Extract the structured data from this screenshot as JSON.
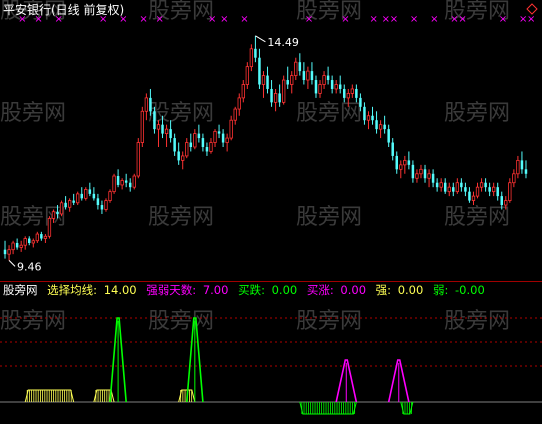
{
  "colors": {
    "up": "#ff3232",
    "down": "#54fcfc",
    "magenta": "#ff00ff",
    "yellow": "#ffff54",
    "green": "#00ff00",
    "white": "#ffffff",
    "gray": "#808080",
    "wm": "#3a3a3a",
    "divider": "#a00000",
    "dotted": "#b00000"
  },
  "header": {
    "title": "平安银行(日线 前复权)",
    "high_label": "14.49",
    "low_label": "9.46",
    "corner_icon": "diamond-icon"
  },
  "watermark": {
    "text": "股旁网"
  },
  "indicator_header": {
    "name": "股旁网",
    "items": [
      {
        "label": "选择均线:",
        "value": "14.00"
      },
      {
        "label": "强弱天数:",
        "value": "7.00"
      },
      {
        "label": "买跌:",
        "value": "0.00"
      },
      {
        "label": "买涨:",
        "value": "0.00"
      },
      {
        "label": "强:",
        "value": "0.00"
      },
      {
        "label": "弱:",
        "value": "-0.00"
      }
    ]
  },
  "chart_data": [
    {
      "type": "candlestick",
      "ylim": [
        9.2,
        14.8
      ],
      "high_marker": 14.49,
      "low_marker": 9.46,
      "x_marks": [
        4,
        8,
        13,
        24,
        29,
        34,
        38,
        51,
        54,
        59,
        75,
        84,
        91,
        94,
        96,
        101,
        106,
        111,
        113,
        123,
        128,
        130,
        135,
        138
      ],
      "ohlc": [
        [
          9.7,
          9.9,
          9.5,
          9.6
        ],
        [
          9.6,
          9.8,
          9.46,
          9.7
        ],
        [
          9.7,
          9.9,
          9.6,
          9.85
        ],
        [
          9.85,
          9.95,
          9.7,
          9.75
        ],
        [
          9.75,
          9.9,
          9.65,
          9.8
        ],
        [
          9.8,
          10.0,
          9.7,
          9.95
        ],
        [
          9.95,
          10.0,
          9.8,
          9.85
        ],
        [
          9.85,
          9.95,
          9.75,
          9.9
        ],
        [
          9.9,
          10.1,
          9.85,
          10.05
        ],
        [
          10.05,
          10.1,
          9.9,
          9.95
        ],
        [
          9.95,
          10.05,
          9.85,
          10.0
        ],
        [
          10.0,
          10.45,
          9.95,
          10.4
        ],
        [
          10.4,
          10.6,
          10.3,
          10.55
        ],
        [
          10.55,
          10.7,
          10.4,
          10.5
        ],
        [
          10.5,
          10.8,
          10.45,
          10.75
        ],
        [
          10.75,
          10.9,
          10.6,
          10.65
        ],
        [
          10.65,
          10.85,
          10.55,
          10.8
        ],
        [
          10.8,
          10.95,
          10.7,
          10.75
        ],
        [
          10.75,
          11.0,
          10.7,
          10.95
        ],
        [
          10.95,
          11.1,
          10.8,
          10.85
        ],
        [
          10.85,
          11.1,
          10.8,
          11.05
        ],
        [
          11.05,
          11.2,
          10.9,
          10.95
        ],
        [
          10.95,
          11.1,
          10.8,
          10.85
        ],
        [
          10.85,
          10.95,
          10.6,
          10.7
        ],
        [
          10.7,
          10.8,
          10.5,
          10.6
        ],
        [
          10.6,
          10.85,
          10.55,
          10.8
        ],
        [
          10.8,
          11.05,
          10.75,
          11.0
        ],
        [
          11.0,
          11.4,
          10.95,
          11.35
        ],
        [
          11.35,
          11.5,
          11.1,
          11.15
        ],
        [
          11.15,
          11.3,
          11.05,
          11.25
        ],
        [
          11.25,
          11.4,
          11.1,
          11.2
        ],
        [
          11.2,
          11.3,
          11.0,
          11.1
        ],
        [
          11.1,
          11.4,
          11.05,
          11.35
        ],
        [
          11.35,
          12.2,
          11.3,
          12.1
        ],
        [
          12.1,
          12.9,
          12.0,
          12.8
        ],
        [
          12.8,
          13.2,
          12.6,
          13.1
        ],
        [
          13.1,
          13.3,
          12.7,
          12.8
        ],
        [
          12.8,
          12.9,
          12.3,
          12.4
        ],
        [
          12.4,
          12.6,
          12.0,
          12.5
        ],
        [
          12.5,
          12.7,
          12.2,
          12.3
        ],
        [
          12.3,
          12.5,
          12.0,
          12.4
        ],
        [
          12.4,
          12.6,
          12.1,
          12.2
        ],
        [
          12.2,
          12.3,
          11.8,
          11.9
        ],
        [
          11.9,
          12.1,
          11.6,
          11.7
        ],
        [
          11.7,
          11.9,
          11.5,
          11.8
        ],
        [
          11.8,
          12.2,
          11.75,
          12.1
        ],
        [
          12.1,
          12.3,
          11.9,
          12.0
        ],
        [
          12.0,
          12.4,
          11.95,
          12.3
        ],
        [
          12.3,
          12.5,
          12.1,
          12.2
        ],
        [
          12.2,
          12.3,
          11.9,
          12.0
        ],
        [
          12.0,
          12.1,
          11.8,
          11.9
        ],
        [
          11.9,
          12.2,
          11.85,
          12.1
        ],
        [
          12.1,
          12.4,
          12.0,
          12.35
        ],
        [
          12.35,
          12.5,
          12.2,
          12.3
        ],
        [
          12.3,
          12.4,
          12.0,
          12.1
        ],
        [
          12.1,
          12.3,
          11.9,
          12.2
        ],
        [
          12.2,
          12.7,
          12.15,
          12.6
        ],
        [
          12.6,
          12.9,
          12.5,
          12.85
        ],
        [
          12.85,
          13.2,
          12.7,
          13.1
        ],
        [
          13.1,
          13.5,
          13.0,
          13.4
        ],
        [
          13.4,
          13.9,
          13.3,
          13.8
        ],
        [
          13.8,
          14.3,
          13.7,
          14.2
        ],
        [
          14.2,
          14.49,
          13.9,
          14.0
        ],
        [
          14.0,
          14.2,
          13.3,
          13.4
        ],
        [
          13.4,
          13.7,
          13.1,
          13.6
        ],
        [
          13.6,
          13.8,
          13.2,
          13.3
        ],
        [
          13.3,
          13.5,
          12.9,
          13.0
        ],
        [
          13.0,
          13.3,
          12.8,
          13.2
        ],
        [
          13.2,
          13.4,
          12.9,
          13.0
        ],
        [
          13.0,
          13.6,
          12.95,
          13.5
        ],
        [
          13.5,
          13.8,
          13.3,
          13.4
        ],
        [
          13.4,
          13.7,
          13.2,
          13.6
        ],
        [
          13.6,
          14.0,
          13.5,
          13.9
        ],
        [
          13.9,
          14.1,
          13.6,
          13.7
        ],
        [
          13.7,
          13.9,
          13.4,
          13.5
        ],
        [
          13.5,
          13.8,
          13.3,
          13.7
        ],
        [
          13.7,
          13.9,
          13.4,
          13.5
        ],
        [
          13.5,
          13.6,
          13.1,
          13.2
        ],
        [
          13.2,
          13.5,
          13.1,
          13.4
        ],
        [
          13.4,
          13.7,
          13.3,
          13.6
        ],
        [
          13.6,
          13.8,
          13.4,
          13.5
        ],
        [
          13.5,
          13.6,
          13.2,
          13.3
        ],
        [
          13.3,
          13.5,
          13.2,
          13.4
        ],
        [
          13.4,
          13.6,
          13.2,
          13.3
        ],
        [
          13.3,
          13.4,
          13.0,
          13.1
        ],
        [
          13.1,
          13.3,
          12.9,
          13.2
        ],
        [
          13.2,
          13.4,
          13.1,
          13.3
        ],
        [
          13.3,
          13.4,
          13.0,
          13.1
        ],
        [
          13.1,
          13.2,
          12.8,
          12.9
        ],
        [
          12.9,
          13.0,
          12.5,
          12.6
        ],
        [
          12.6,
          12.8,
          12.4,
          12.7
        ],
        [
          12.7,
          12.9,
          12.5,
          12.6
        ],
        [
          12.6,
          12.8,
          12.3,
          12.4
        ],
        [
          12.4,
          12.6,
          12.2,
          12.5
        ],
        [
          12.5,
          12.7,
          12.3,
          12.4
        ],
        [
          12.4,
          12.5,
          12.0,
          12.1
        ],
        [
          12.1,
          12.2,
          11.7,
          11.8
        ],
        [
          11.8,
          11.9,
          11.4,
          11.5
        ],
        [
          11.5,
          11.7,
          11.3,
          11.6
        ],
        [
          11.6,
          11.8,
          11.4,
          11.7
        ],
        [
          11.7,
          11.9,
          11.5,
          11.6
        ],
        [
          11.6,
          11.7,
          11.2,
          11.3
        ],
        [
          11.3,
          11.5,
          11.2,
          11.4
        ],
        [
          11.4,
          11.6,
          11.3,
          11.5
        ],
        [
          11.5,
          11.6,
          11.2,
          11.3
        ],
        [
          11.3,
          11.5,
          11.1,
          11.4
        ],
        [
          11.4,
          11.5,
          11.1,
          11.2
        ],
        [
          11.2,
          11.3,
          11.0,
          11.1
        ],
        [
          11.1,
          11.3,
          11.0,
          11.2
        ],
        [
          11.2,
          11.3,
          10.95,
          11.0
        ],
        [
          11.0,
          11.2,
          10.9,
          11.1
        ],
        [
          11.1,
          11.2,
          10.9,
          11.0
        ],
        [
          11.0,
          11.3,
          10.95,
          11.2
        ],
        [
          11.2,
          11.3,
          11.0,
          11.1
        ],
        [
          11.1,
          11.2,
          10.9,
          11.0
        ],
        [
          11.0,
          11.1,
          10.75,
          10.8
        ],
        [
          10.8,
          11.0,
          10.7,
          10.9
        ],
        [
          10.9,
          11.2,
          10.85,
          11.1
        ],
        [
          11.1,
          11.3,
          11.0,
          11.2
        ],
        [
          11.2,
          11.3,
          11.0,
          11.1
        ],
        [
          11.1,
          11.2,
          10.9,
          11.0
        ],
        [
          11.0,
          11.2,
          10.9,
          11.1
        ],
        [
          11.1,
          11.2,
          10.8,
          10.9
        ],
        [
          10.9,
          11.0,
          10.6,
          10.7
        ],
        [
          10.7,
          10.9,
          10.6,
          10.8
        ],
        [
          10.8,
          11.3,
          10.75,
          11.2
        ],
        [
          11.2,
          11.5,
          11.1,
          11.4
        ],
        [
          11.4,
          11.8,
          11.3,
          11.7
        ],
        [
          11.7,
          11.9,
          11.4,
          11.5
        ],
        [
          11.5,
          11.7,
          11.3,
          11.4
        ]
      ]
    },
    {
      "type": "indicator",
      "ylim": [
        -1.5,
        8.5
      ],
      "dotted_levels": [
        3,
        5,
        7
      ],
      "series": [
        {
          "color": "yellow",
          "style": "hatched",
          "segments": [
            [
              5,
              17,
              1
            ],
            [
              22,
              27,
              1
            ],
            [
              43,
              47,
              1
            ]
          ]
        },
        {
          "color": "green",
          "style": "spike",
          "segments": [
            [
              26,
              30,
              7
            ]
          ]
        },
        {
          "color": "green",
          "style": "spike",
          "segments": [
            [
              45,
              49,
              7
            ]
          ]
        },
        {
          "color": "green",
          "style": "hatched",
          "segments": [
            [
              73,
              87,
              -1
            ],
            [
              98,
              101,
              -1
            ]
          ]
        },
        {
          "color": "magenta",
          "style": "spike",
          "segments": [
            [
              82,
              87,
              3.5
            ],
            [
              95,
              100,
              3.5
            ]
          ]
        }
      ]
    }
  ]
}
